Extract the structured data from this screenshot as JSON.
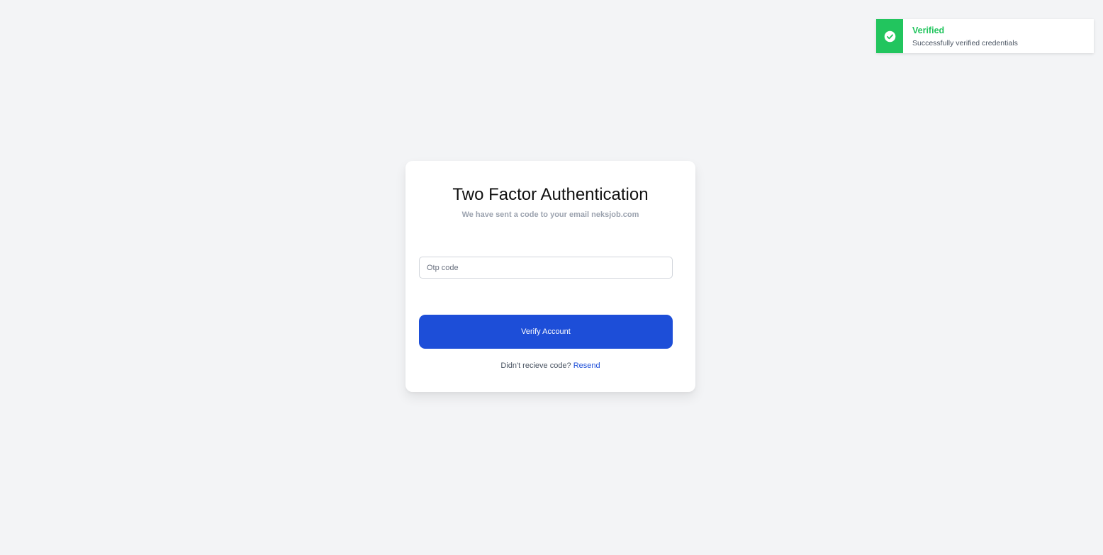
{
  "toast": {
    "title": "Verified",
    "message": "Successfully verified credentials",
    "icon": "check-circle-icon",
    "color": "#22c55e"
  },
  "card": {
    "title": "Two Factor Authentication",
    "subtitle": "We have sent a code to your email neksjob.com",
    "otp_input": {
      "placeholder": "Otp code",
      "value": ""
    },
    "verify_button_label": "Verify Account",
    "resend_prompt": "Didn't recieve code?",
    "resend_link_label": "Resend"
  },
  "colors": {
    "background": "#f3f4f6",
    "primary": "#1d4ed8",
    "success": "#22c55e"
  }
}
